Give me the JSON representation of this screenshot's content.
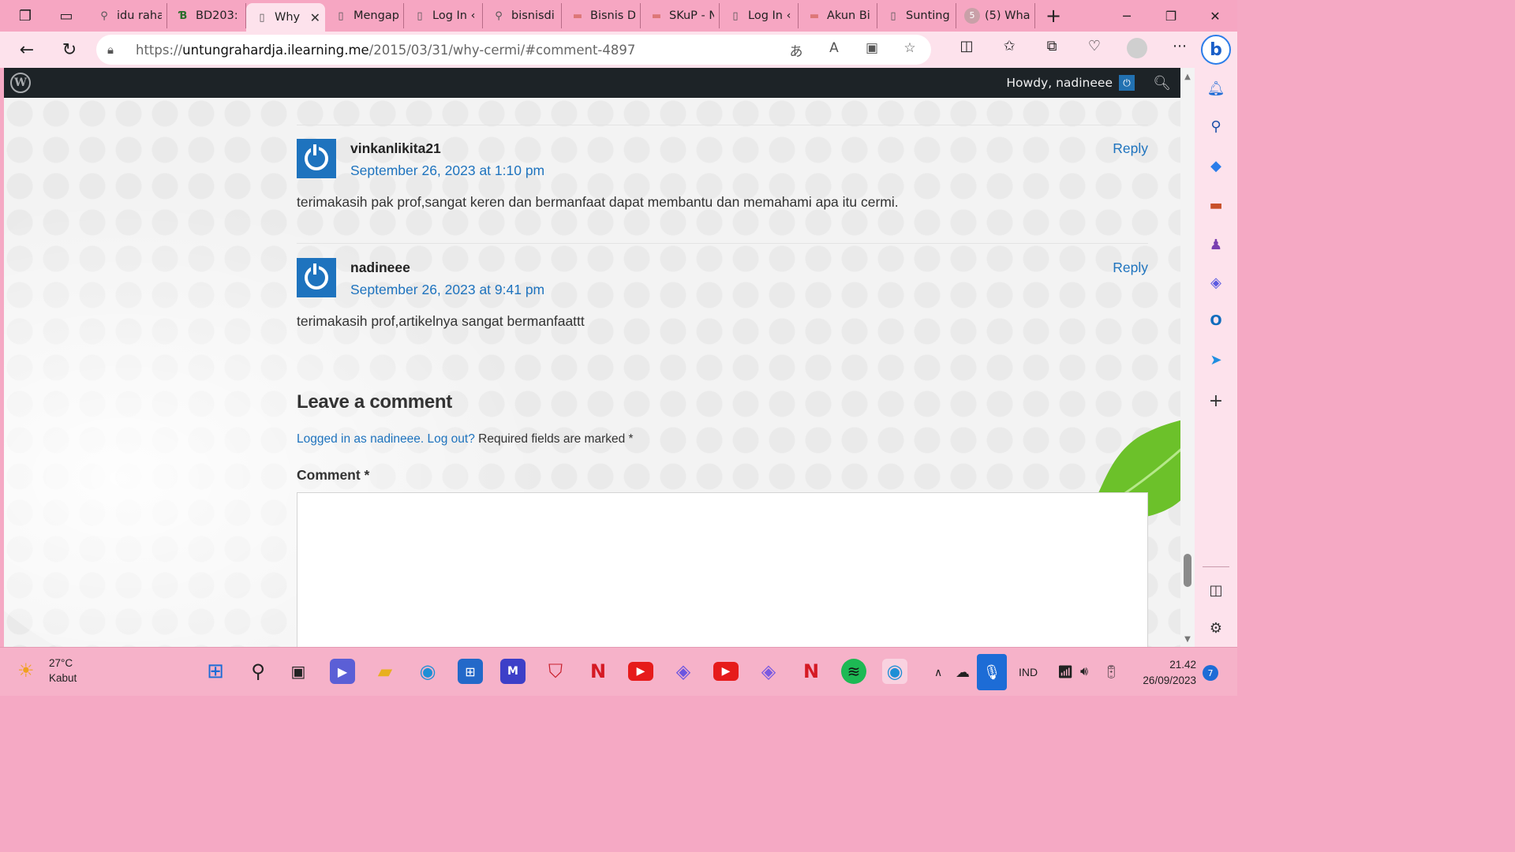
{
  "browser": {
    "tabs": [
      {
        "label": "idu raha",
        "icon": "search-icon"
      },
      {
        "label": "BD203: /",
        "icon": "site-favicon"
      },
      {
        "label": "Why",
        "icon": "page-icon",
        "active": true
      },
      {
        "label": "Mengap",
        "icon": "page-icon"
      },
      {
        "label": "Log In ‹",
        "icon": "page-icon"
      },
      {
        "label": "bisnisdi",
        "icon": "search-icon"
      },
      {
        "label": "Bisnis D",
        "icon": "site-favicon"
      },
      {
        "label": "SKuP - N",
        "icon": "site-favicon"
      },
      {
        "label": "Log In ‹",
        "icon": "page-icon"
      },
      {
        "label": "Akun Bi",
        "icon": "site-favicon"
      },
      {
        "label": "Sunting",
        "icon": "page-icon"
      },
      {
        "label": "(5) Wha",
        "icon": "whatsapp-icon",
        "badge": "5"
      }
    ],
    "url_prefix": "https://",
    "url_domain": "untungrahardja.ilearning.me",
    "url_path": "/2015/03/31/why-cermi/#comment-4897"
  },
  "wp": {
    "howdy": "Howdy, nadineee"
  },
  "comments": [
    {
      "author": "vinkanlikita21",
      "date": "September 26, 2023 at 1:10 pm",
      "reply": "Reply",
      "text": "terimakasih pak prof,sangat keren dan bermanfaat dapat membantu dan memahami apa itu cermi."
    },
    {
      "author": "nadineee",
      "date": "September 26, 2023 at 9:41 pm",
      "reply": "Reply",
      "text": "terimakasih prof,artikelnya sangat bermanfaattt"
    }
  ],
  "form": {
    "title": "Leave a comment",
    "logged_in_link": "Logged in as nadineee.",
    "logout_link": "Log out?",
    "required_note": "Required fields are marked *",
    "comment_label": "Comment *"
  },
  "taskbar": {
    "temperature": "27°C",
    "weather": "Kabut",
    "language": "IND",
    "time": "21.42",
    "date": "26/09/2023",
    "notifications": "7"
  }
}
